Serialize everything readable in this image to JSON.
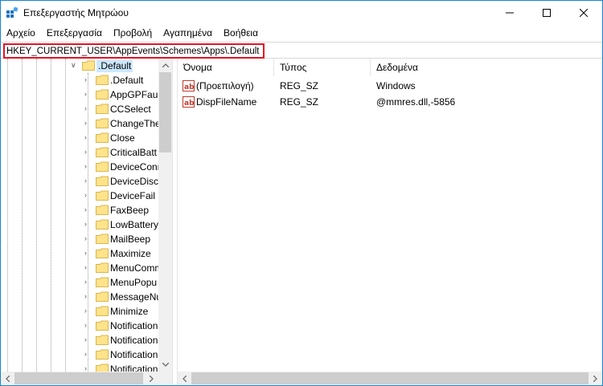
{
  "window": {
    "title": "Επεξεργαστής Μητρώου"
  },
  "menu": [
    {
      "label": "Αρχείο"
    },
    {
      "label": "Επεξεργασία"
    },
    {
      "label": "Προβολή"
    },
    {
      "label": "Αγαπημένα"
    },
    {
      "label": "Βοήθεια"
    }
  ],
  "address": {
    "value": "HKEY_CURRENT_USER\\AppEvents\\Schemes\\Apps\\.Default"
  },
  "tree": {
    "parent": {
      "label": ".Default",
      "selected": true
    },
    "children": [
      {
        "label": ".Default"
      },
      {
        "label": "AppGPFault"
      },
      {
        "label": "CCSelect"
      },
      {
        "label": "ChangeThe"
      },
      {
        "label": "Close"
      },
      {
        "label": "CriticalBatt"
      },
      {
        "label": "DeviceConn"
      },
      {
        "label": "DeviceDisco"
      },
      {
        "label": "DeviceFail"
      },
      {
        "label": "FaxBeep"
      },
      {
        "label": "LowBattery"
      },
      {
        "label": "MailBeep"
      },
      {
        "label": "Maximize"
      },
      {
        "label": "MenuComm"
      },
      {
        "label": "MenuPopu"
      },
      {
        "label": "MessageNu"
      },
      {
        "label": "Minimize"
      },
      {
        "label": "Notification"
      },
      {
        "label": "Notification"
      },
      {
        "label": "Notification"
      },
      {
        "label": "Notification"
      }
    ]
  },
  "list": {
    "columns": [
      {
        "label": "Όνομα"
      },
      {
        "label": "Τύπος"
      },
      {
        "label": "Δεδομένα"
      }
    ],
    "rows": [
      {
        "name": "(Προεπιλογή)",
        "type": "REG_SZ",
        "data": "Windows",
        "icon": "string-value-icon"
      },
      {
        "name": "DispFileName",
        "type": "REG_SZ",
        "data": "@mmres.dll,-5856",
        "icon": "string-value-icon"
      }
    ]
  },
  "colors": {
    "selection": "#cce8ff",
    "highlight_border": "#e81123",
    "folder": "#ffe38a"
  }
}
